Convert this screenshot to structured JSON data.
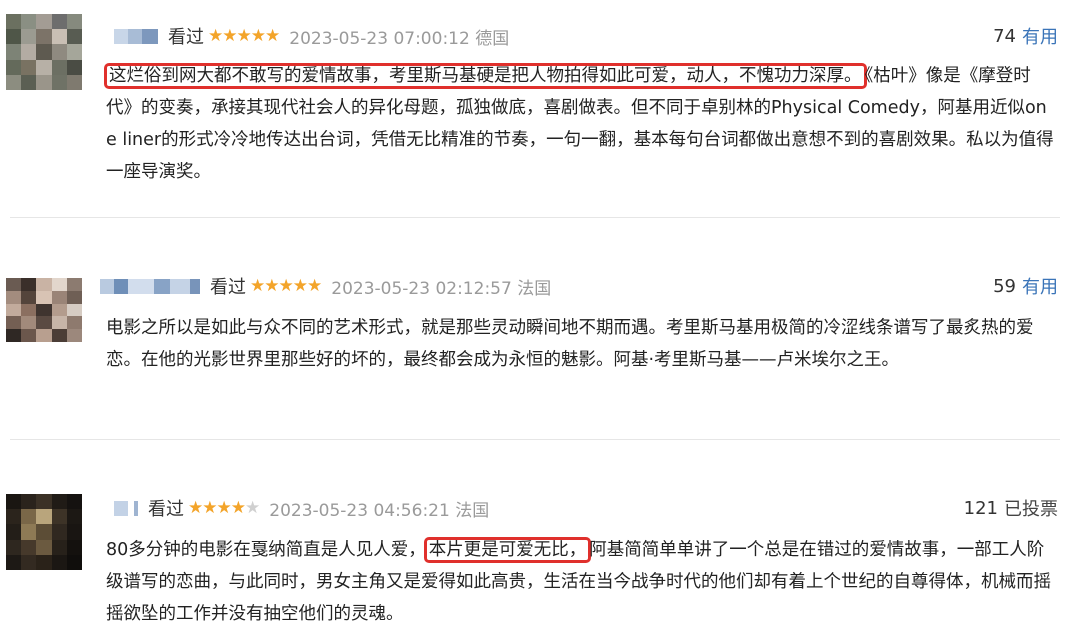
{
  "reviews": [
    {
      "status": "看过",
      "rating": 5,
      "meta": "2023-05-23 07:00:12 德国",
      "vote_count": "74",
      "vote_label": "有用",
      "text_highlight": "这烂俗到网大都不敢写的爱情故事，考里斯马基硬是把人物拍得如此可爱，动人，不愧功力深厚。",
      "text_rest": "《枯叶》像是《摩登时代》的变奏，承接其现代社会人的异化母题，孤独做底，喜剧做表。但不同于卓别林的Physical Comedy，阿基用近似one liner的形式冷冷地传达出台词，凭借无比精准的节奏，一句一翻，基本每句台词都做出意想不到的喜剧效果。私以为值得一座导演奖。"
    },
    {
      "status": "看过",
      "rating": 5,
      "meta": "2023-05-23 02:12:57 法国",
      "vote_count": "59",
      "vote_label": "有用",
      "text": "电影之所以是如此与众不同的艺术形式，就是那些灵动瞬间地不期而遇。考里斯马基用极简的冷涩线条谱写了最炙热的爱恋。在他的光影世界里那些好的坏的，最终都会成为永恒的魅影。阿基·考里斯马基——卢米埃尔之王。"
    },
    {
      "status": "看过",
      "rating": 4,
      "meta": "2023-05-23 04:56:21 法国",
      "vote_count": "121",
      "vote_label": "已投票",
      "text_before": "80多分钟的电影在戛纳简直是人见人爱，",
      "text_highlight": "本片更是可爱无比，",
      "text_after": "阿基简简单单讲了一个总是在错过的爱情故事，一部工人阶级谱写的恋曲，与此同时，男女主角又是爱得如此高贵，生活在当今战争时代的他们却有着上个世纪的自尊得体，机械而摇摇欲坠的工作并没有抽空他们的灵魂。"
    }
  ],
  "colors": {
    "star": "#f3a42a",
    "useful": "#3a74b8",
    "highlight_box": "#e0302c",
    "meta_text": "#9a9a9a"
  },
  "icons": [
    "star-icon",
    "blurred-avatar",
    "blurred-username"
  ]
}
